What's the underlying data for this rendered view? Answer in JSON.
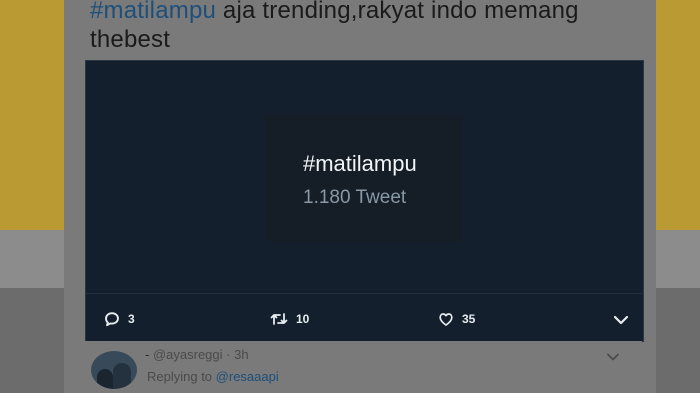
{
  "tweet": {
    "hashtag": "#matilampu",
    "text": " aja trending,rakyat indo memang thebest"
  },
  "trend_card": {
    "tag": "#matilampu",
    "count": "1.180 Tweet"
  },
  "actions": {
    "reply_count": "3",
    "retweet_count": "10",
    "like_count": "35"
  },
  "reply_tweet": {
    "name": "-",
    "handle": "@ayasreggi",
    "separator": "·",
    "time": "3h",
    "replying_prefix": "Replying to",
    "replying_to": "@resaaapi"
  },
  "colors": {
    "media_bg": "#131f2c",
    "hashtag": "#1d4f7a"
  }
}
